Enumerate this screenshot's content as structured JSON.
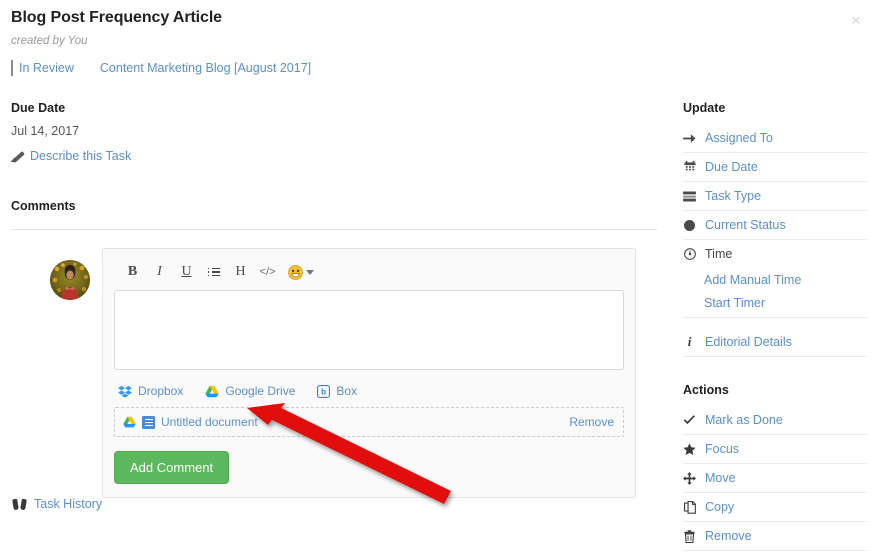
{
  "window": {
    "close_label": "×"
  },
  "task": {
    "title": "Blog Post Frequency Article",
    "created_by": "created by You",
    "status_label": "In Review",
    "status_icon": "task-type-lines-icon",
    "project_label": "Content Marketing Blog [August 2017]",
    "project_icon": "status-sphere-icon",
    "due_date_label": "Due Date",
    "due_date_value": "Jul 14, 2017",
    "describe_label": "Describe this Task",
    "describe_icon": "pencil-icon"
  },
  "comments": {
    "heading": "Comments",
    "avatar_alt": "user-avatar",
    "toolbar": [
      {
        "name": "bold-button",
        "label": "B"
      },
      {
        "name": "italic-button",
        "label": "I"
      },
      {
        "name": "underline-button",
        "label": "U"
      },
      {
        "name": "bullet-list-button",
        "label": ""
      },
      {
        "name": "heading-button",
        "label": "H"
      },
      {
        "name": "code-button",
        "label": "</>"
      },
      {
        "name": "emoji-button",
        "label": "😀"
      }
    ],
    "input_value": "",
    "input_placeholder": "",
    "cloud_sources": [
      {
        "name": "dropbox",
        "label": "Dropbox"
      },
      {
        "name": "google-drive",
        "label": "Google Drive"
      },
      {
        "name": "box",
        "label": "Box"
      }
    ],
    "attachment": {
      "name": "Untitled document",
      "remove_label": "Remove",
      "source_icon": "google-drive-icon",
      "type_icon": "google-doc-icon"
    },
    "submit_label": "Add Comment"
  },
  "task_history": {
    "label": "Task History",
    "icon": "binoculars-icon"
  },
  "sidebar": {
    "update_heading": "Update",
    "update_items": [
      {
        "label": "Assigned To",
        "icon": "arrow-right-icon",
        "link": true
      },
      {
        "label": "Due Date",
        "icon": "calendar-icon",
        "link": true
      },
      {
        "label": "Task Type",
        "icon": "task-type-icon",
        "link": true
      },
      {
        "label": "Current Status",
        "icon": "circle-icon",
        "link": true
      },
      {
        "label": "Time",
        "icon": "clock-icon",
        "link": false
      }
    ],
    "time_sub_items": [
      {
        "label": "Add Manual Time"
      },
      {
        "label": "Start Timer"
      }
    ],
    "editorial": {
      "label": "Editorial Details",
      "icon": "info-icon"
    },
    "actions_heading": "Actions",
    "action_items": [
      {
        "label": "Mark as Done",
        "icon": "check-icon"
      },
      {
        "label": "Focus",
        "icon": "star-icon"
      },
      {
        "label": "Move",
        "icon": "move-arrows-icon"
      },
      {
        "label": "Copy",
        "icon": "copy-icon"
      },
      {
        "label": "Remove",
        "icon": "trash-icon"
      }
    ]
  },
  "colors": {
    "link": "#5a8fd0",
    "primary_button": "#5cb85c",
    "annotation_arrow": "#e01010",
    "text": "#333333"
  }
}
